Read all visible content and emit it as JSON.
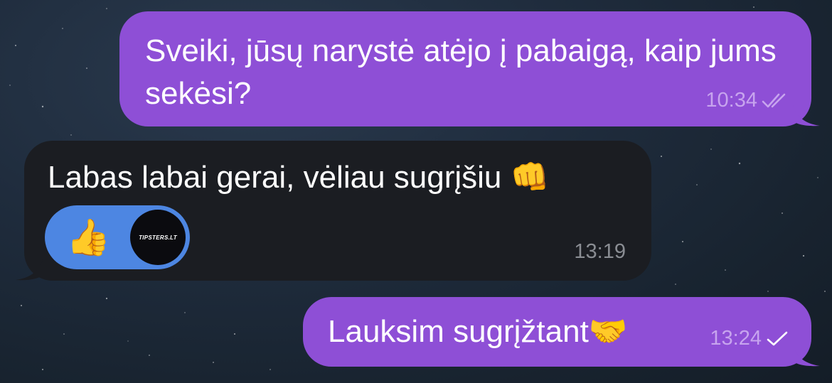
{
  "messages": [
    {
      "direction": "outgoing",
      "text": "Sveiki, jūsų narystė atėjo į pabaigą, kaip jums sekėsi?",
      "time": "10:34",
      "status": "read",
      "status_icon": "double-check-icon"
    },
    {
      "direction": "incoming",
      "text": "Labas labai gerai, vėliau sugrįšiu",
      "emoji": "👊",
      "time": "13:19",
      "reaction": {
        "emoji": "👍",
        "avatar_text": "TIPSTERS.LT"
      }
    },
    {
      "direction": "outgoing",
      "text": "Lauksim sugrįžtant",
      "emoji": "🤝",
      "time": "13:24",
      "status": "sent",
      "status_icon": "single-check-icon"
    }
  ],
  "colors": {
    "outgoing_bubble": "#8e4fd6",
    "incoming_bubble": "#1b1d22",
    "reaction_pill": "#4d86e2",
    "background": "#1f2c3d"
  }
}
